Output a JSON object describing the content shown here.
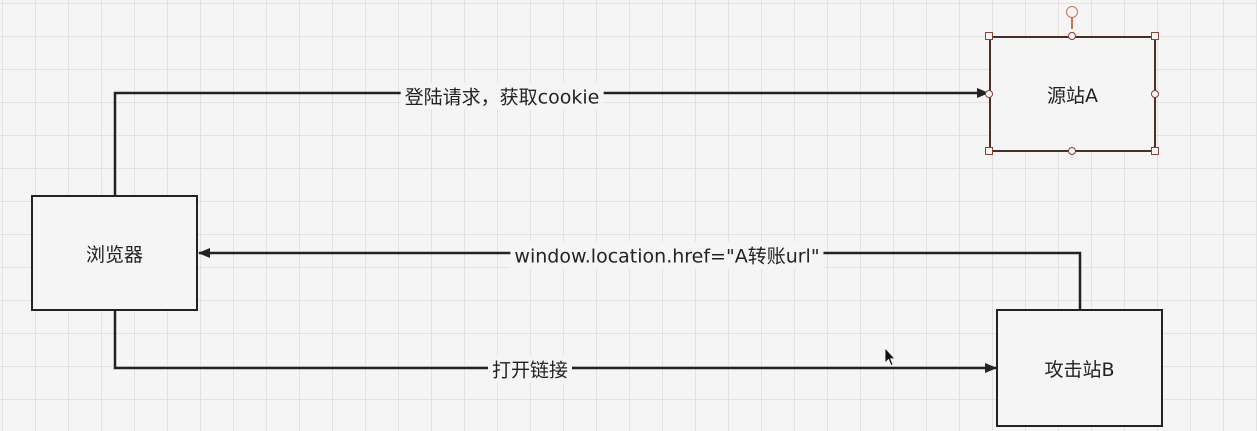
{
  "nodes": {
    "browser": {
      "label": "浏览器"
    },
    "source_a": {
      "label": "源站A"
    },
    "attacker_b": {
      "label": "攻击站B"
    }
  },
  "edges": {
    "login": {
      "label": "登陆请求，获取cookie"
    },
    "redirect": {
      "label": "window.location.href=\"A转账url\""
    },
    "open_link": {
      "label": "打开链接"
    }
  },
  "colors": {
    "line": "#222222",
    "grid": "#e2e2e2",
    "selection": "#8a3f33"
  }
}
